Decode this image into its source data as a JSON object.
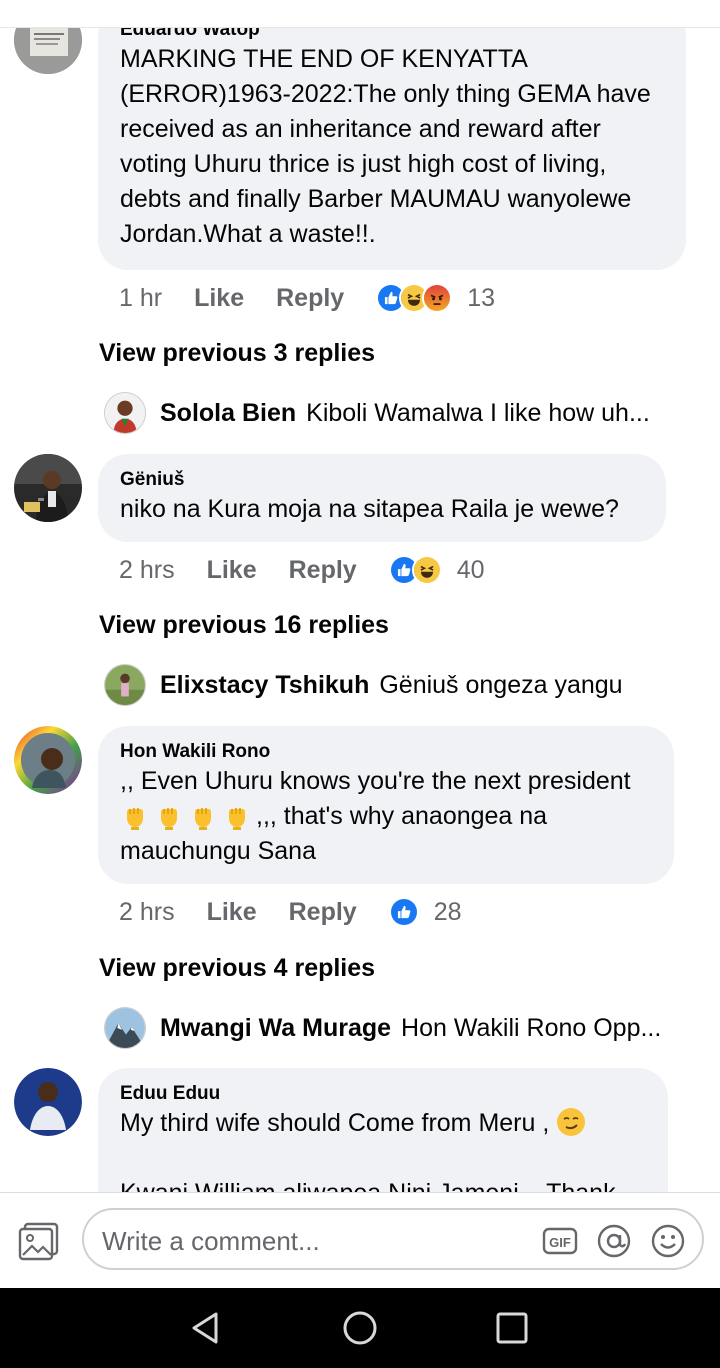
{
  "comments": [
    {
      "author": "Eduardo Watop",
      "lines": [
        "MARKING THE END OF KENYATTA",
        "(ERROR)1963-2022:The only thing GEMA have",
        "received as an inheritance and reward after",
        "voting Uhuru thrice is just high cost of living,",
        "debts and finally Barber MAUMAU wanyolewe",
        "Jordan.What a waste!!."
      ],
      "time": "1 hr",
      "like": "Like",
      "reply": "Reply",
      "reactions": [
        "like-icon",
        "haha-icon",
        "angry-icon"
      ],
      "reaction_count": "13"
    },
    {
      "author": "Gëniuš",
      "lines": [
        "niko na Kura moja na sitapea Raila je wewe?"
      ],
      "time": "2 hrs",
      "like": "Like",
      "reply": "Reply",
      "reactions": [
        "like-icon",
        "haha-icon"
      ],
      "reaction_count": "40"
    },
    {
      "author": "Hon Wakili Rono",
      "line1": ",, Even Uhuru knows you're the next president",
      "line2_suffix": ",,, that's why anaongea na",
      "line3": "mauchungu Sana",
      "time": "2 hrs",
      "like": "Like",
      "reply": "Reply",
      "reactions": [
        "like-icon"
      ],
      "reaction_count": "28"
    },
    {
      "author": "Eduu Eduu",
      "line1": "My third wife should Come from Meru ,",
      "line3": "Kwani William aliwapea Nini Jameni... Thank"
    }
  ],
  "threads": [
    {
      "view_previous": "View previous 3 replies",
      "reply_name": "Solola Bien",
      "reply_text": "Kiboli Wamalwa I like how uh..."
    },
    {
      "view_previous": "View previous 16 replies",
      "reply_name": "Elixstacy Tshikuh",
      "reply_text": "Gëniuš ongeza yangu"
    },
    {
      "view_previous": "View previous 4 replies",
      "reply_name": "Mwangi Wa Murage",
      "reply_text": "Hon Wakili Rono Opp..."
    }
  ],
  "composer": {
    "placeholder": "Write a comment...",
    "icons": [
      "photo-icon",
      "gif-icon",
      "mention-icon",
      "emoji-icon"
    ]
  },
  "navbar": {
    "icons": [
      "back-icon",
      "home-icon",
      "recents-icon"
    ]
  },
  "colors": {
    "bubble": "#f0f2f5",
    "text": "#050505",
    "meta": "#65676b",
    "like_blue": "#1877f2",
    "haha_yellow": "#f7c844",
    "angry_orange": "#e9710f"
  }
}
